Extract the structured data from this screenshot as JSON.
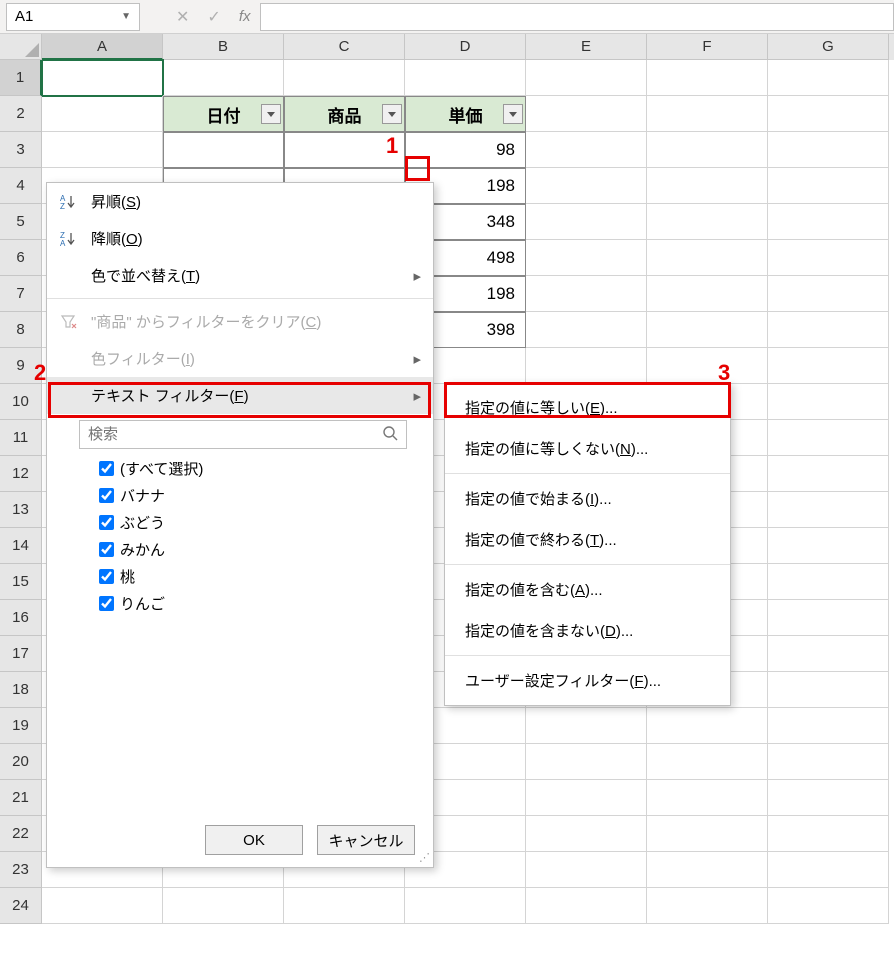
{
  "formula_bar": {
    "name_box": "A1",
    "cancel_glyph": "✕",
    "enter_glyph": "✓",
    "fx_label": "fx"
  },
  "columns": [
    "A",
    "B",
    "C",
    "D",
    "E",
    "F",
    "G"
  ],
  "row_count": 24,
  "selected_cell": "A1",
  "headers": {
    "B": "日付",
    "C": "商品",
    "D": "単価"
  },
  "data_D": [
    "98",
    "198",
    "348",
    "498",
    "198",
    "398"
  ],
  "callouts": {
    "c1": "1",
    "c2": "2",
    "c3": "3"
  },
  "filter_menu": {
    "sort_asc": {
      "icon": "A↓Z",
      "label": "昇順(",
      "key": "S",
      "suffix": ")"
    },
    "sort_desc": {
      "icon": "Z↓A",
      "label": "降順(",
      "key": "O",
      "suffix": ")"
    },
    "sort_color": {
      "label": "色で並べ替え(",
      "key": "T",
      "suffix": ")"
    },
    "clear": {
      "label_pre": "\"商品\" からフィルターをクリア(",
      "key": "C",
      "suffix": ")"
    },
    "color_filter": {
      "label": "色フィルター(",
      "key": "I",
      "suffix": ")"
    },
    "text_filter": {
      "label": "テキスト フィルター(",
      "key": "F",
      "suffix": ")"
    },
    "search_placeholder": "検索",
    "items": [
      "(すべて選択)",
      "バナナ",
      "ぶどう",
      "みかん",
      "桃",
      "りんご"
    ],
    "ok": "OK",
    "cancel": "キャンセル"
  },
  "submenu": {
    "equals": {
      "label": "指定の値に等しい(",
      "key": "E",
      "suffix": ")..."
    },
    "not_equals": {
      "label": "指定の値に等しくない(",
      "key": "N",
      "suffix": ")..."
    },
    "begins": {
      "label": "指定の値で始まる(",
      "key": "I",
      "suffix": ")..."
    },
    "ends": {
      "label": "指定の値で終わる(",
      "key": "T",
      "suffix": ")..."
    },
    "contains": {
      "label": "指定の値を含む(",
      "key": "A",
      "suffix": ")..."
    },
    "not_contains": {
      "label": "指定の値を含まない(",
      "key": "D",
      "suffix": ")..."
    },
    "custom": {
      "label": "ユーザー設定フィルター(",
      "key": "F",
      "suffix": ")..."
    }
  }
}
